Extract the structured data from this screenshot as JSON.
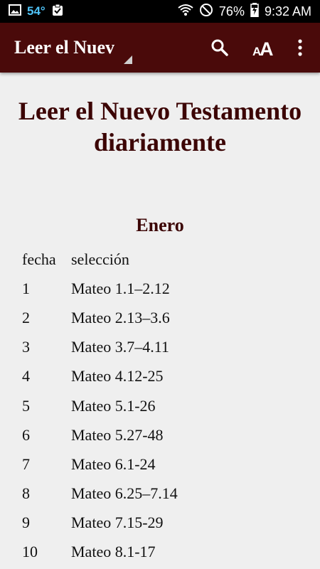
{
  "status_bar": {
    "temperature": "54°",
    "battery": "76%",
    "time": "9:32 AM"
  },
  "toolbar": {
    "title": "Leer el Nuev"
  },
  "content": {
    "title": "Leer el Nuevo Testamento diariamente",
    "month": "Enero",
    "header": {
      "day": "fecha",
      "selection": "selección"
    },
    "rows": [
      {
        "day": "1",
        "selection": "Mateo 1.1–2.12"
      },
      {
        "day": "2",
        "selection": "Mateo 2.13–3.6"
      },
      {
        "day": "3",
        "selection": "Mateo 3.7–4.11"
      },
      {
        "day": "4",
        "selection": "Mateo 4.12-25"
      },
      {
        "day": "5",
        "selection": "Mateo 5.1-26"
      },
      {
        "day": "6",
        "selection": "Mateo 5.27-48"
      },
      {
        "day": "7",
        "selection": "Mateo 6.1-24"
      },
      {
        "day": "8",
        "selection": "Mateo 6.25–7.14"
      },
      {
        "day": "9",
        "selection": "Mateo 7.15-29"
      },
      {
        "day": "10",
        "selection": "Mateo 8.1-17"
      }
    ]
  }
}
